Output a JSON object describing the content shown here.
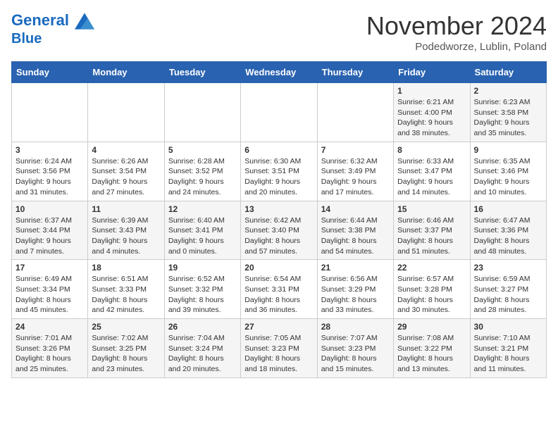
{
  "header": {
    "logo_line1": "General",
    "logo_line2": "Blue",
    "month_title": "November 2024",
    "subtitle": "Podedworze, Lublin, Poland"
  },
  "weekdays": [
    "Sunday",
    "Monday",
    "Tuesday",
    "Wednesday",
    "Thursday",
    "Friday",
    "Saturday"
  ],
  "weeks": [
    [
      {
        "day": "",
        "info": ""
      },
      {
        "day": "",
        "info": ""
      },
      {
        "day": "",
        "info": ""
      },
      {
        "day": "",
        "info": ""
      },
      {
        "day": "",
        "info": ""
      },
      {
        "day": "1",
        "info": "Sunrise: 6:21 AM\nSunset: 4:00 PM\nDaylight: 9 hours and 38 minutes."
      },
      {
        "day": "2",
        "info": "Sunrise: 6:23 AM\nSunset: 3:58 PM\nDaylight: 9 hours and 35 minutes."
      }
    ],
    [
      {
        "day": "3",
        "info": "Sunrise: 6:24 AM\nSunset: 3:56 PM\nDaylight: 9 hours and 31 minutes."
      },
      {
        "day": "4",
        "info": "Sunrise: 6:26 AM\nSunset: 3:54 PM\nDaylight: 9 hours and 27 minutes."
      },
      {
        "day": "5",
        "info": "Sunrise: 6:28 AM\nSunset: 3:52 PM\nDaylight: 9 hours and 24 minutes."
      },
      {
        "day": "6",
        "info": "Sunrise: 6:30 AM\nSunset: 3:51 PM\nDaylight: 9 hours and 20 minutes."
      },
      {
        "day": "7",
        "info": "Sunrise: 6:32 AM\nSunset: 3:49 PM\nDaylight: 9 hours and 17 minutes."
      },
      {
        "day": "8",
        "info": "Sunrise: 6:33 AM\nSunset: 3:47 PM\nDaylight: 9 hours and 14 minutes."
      },
      {
        "day": "9",
        "info": "Sunrise: 6:35 AM\nSunset: 3:46 PM\nDaylight: 9 hours and 10 minutes."
      }
    ],
    [
      {
        "day": "10",
        "info": "Sunrise: 6:37 AM\nSunset: 3:44 PM\nDaylight: 9 hours and 7 minutes."
      },
      {
        "day": "11",
        "info": "Sunrise: 6:39 AM\nSunset: 3:43 PM\nDaylight: 9 hours and 4 minutes."
      },
      {
        "day": "12",
        "info": "Sunrise: 6:40 AM\nSunset: 3:41 PM\nDaylight: 9 hours and 0 minutes."
      },
      {
        "day": "13",
        "info": "Sunrise: 6:42 AM\nSunset: 3:40 PM\nDaylight: 8 hours and 57 minutes."
      },
      {
        "day": "14",
        "info": "Sunrise: 6:44 AM\nSunset: 3:38 PM\nDaylight: 8 hours and 54 minutes."
      },
      {
        "day": "15",
        "info": "Sunrise: 6:46 AM\nSunset: 3:37 PM\nDaylight: 8 hours and 51 minutes."
      },
      {
        "day": "16",
        "info": "Sunrise: 6:47 AM\nSunset: 3:36 PM\nDaylight: 8 hours and 48 minutes."
      }
    ],
    [
      {
        "day": "17",
        "info": "Sunrise: 6:49 AM\nSunset: 3:34 PM\nDaylight: 8 hours and 45 minutes."
      },
      {
        "day": "18",
        "info": "Sunrise: 6:51 AM\nSunset: 3:33 PM\nDaylight: 8 hours and 42 minutes."
      },
      {
        "day": "19",
        "info": "Sunrise: 6:52 AM\nSunset: 3:32 PM\nDaylight: 8 hours and 39 minutes."
      },
      {
        "day": "20",
        "info": "Sunrise: 6:54 AM\nSunset: 3:31 PM\nDaylight: 8 hours and 36 minutes."
      },
      {
        "day": "21",
        "info": "Sunrise: 6:56 AM\nSunset: 3:29 PM\nDaylight: 8 hours and 33 minutes."
      },
      {
        "day": "22",
        "info": "Sunrise: 6:57 AM\nSunset: 3:28 PM\nDaylight: 8 hours and 30 minutes."
      },
      {
        "day": "23",
        "info": "Sunrise: 6:59 AM\nSunset: 3:27 PM\nDaylight: 8 hours and 28 minutes."
      }
    ],
    [
      {
        "day": "24",
        "info": "Sunrise: 7:01 AM\nSunset: 3:26 PM\nDaylight: 8 hours and 25 minutes."
      },
      {
        "day": "25",
        "info": "Sunrise: 7:02 AM\nSunset: 3:25 PM\nDaylight: 8 hours and 23 minutes."
      },
      {
        "day": "26",
        "info": "Sunrise: 7:04 AM\nSunset: 3:24 PM\nDaylight: 8 hours and 20 minutes."
      },
      {
        "day": "27",
        "info": "Sunrise: 7:05 AM\nSunset: 3:23 PM\nDaylight: 8 hours and 18 minutes."
      },
      {
        "day": "28",
        "info": "Sunrise: 7:07 AM\nSunset: 3:23 PM\nDaylight: 8 hours and 15 minutes."
      },
      {
        "day": "29",
        "info": "Sunrise: 7:08 AM\nSunset: 3:22 PM\nDaylight: 8 hours and 13 minutes."
      },
      {
        "day": "30",
        "info": "Sunrise: 7:10 AM\nSunset: 3:21 PM\nDaylight: 8 hours and 11 minutes."
      }
    ]
  ]
}
